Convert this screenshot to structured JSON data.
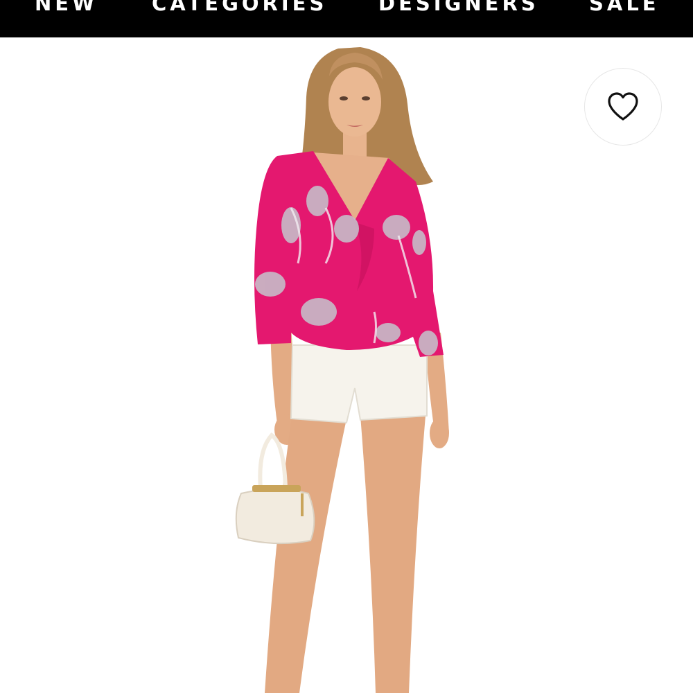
{
  "nav": {
    "items": [
      {
        "label": "NEW"
      },
      {
        "label": "CATEGORIES"
      },
      {
        "label": "DESIGNERS"
      },
      {
        "label": "SALE"
      }
    ]
  },
  "product": {
    "image": "model wearing pink floral ruffle blouse with white shorts and cream handbag",
    "favorite_icon": "heart-outline-icon"
  },
  "colors": {
    "nav_bg": "#000000",
    "nav_text": "#ffffff",
    "blouse": "#e4186f",
    "shorts": "#f6f3ec"
  }
}
